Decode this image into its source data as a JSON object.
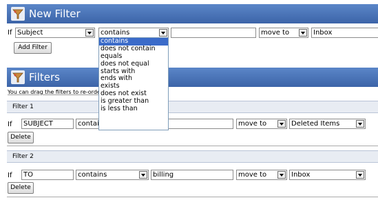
{
  "new_filter": {
    "title": "New Filter",
    "if_label": "If",
    "field_value": "Subject",
    "operator_value": "contains",
    "text_value": "",
    "move_to_value": "move to",
    "folder_value": "Inbox",
    "add_button": "Add Filter"
  },
  "operator_dropdown": {
    "options": [
      "contains",
      "does not contain",
      "equals",
      "does not equal",
      "starts with",
      "ends with",
      "exists",
      "does not exist",
      "is greater than",
      "is less than"
    ],
    "selected_index": 0
  },
  "filters": {
    "title": "Filters",
    "hint": "You can drag the filters to re-order"
  },
  "filter1": {
    "header": "Filter 1",
    "if_label": "If",
    "field_value": "SUBJECT",
    "operator_value": "contains",
    "text_value": "",
    "move_to_value": "move to",
    "folder_value": "Deleted Items",
    "delete_button": "Delete"
  },
  "filter2": {
    "header": "Filter 2",
    "if_label": "If",
    "field_value": "TO",
    "operator_value": "contains",
    "text_value": "billing",
    "move_to_value": "move to",
    "folder_value": "Inbox",
    "delete_button": "Delete"
  },
  "colors": {
    "header_bg": "#4a74b8",
    "selected_option_bg": "#3b6bc9"
  }
}
